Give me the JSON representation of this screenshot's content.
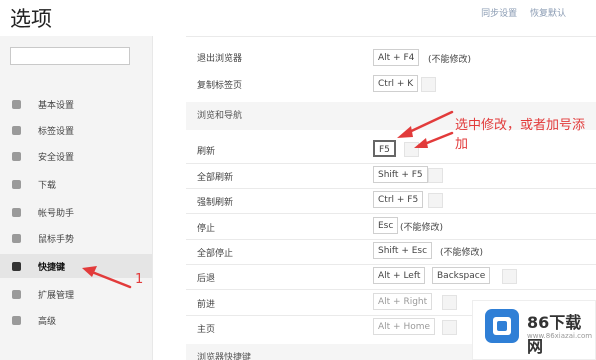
{
  "header": {
    "title": "选项",
    "link1": "同步设置",
    "link2": "恢复默认"
  },
  "sidebar": {
    "search_placeholder": "",
    "items": [
      {
        "label": "基本设置",
        "icon": "settings-icon"
      },
      {
        "label": "标签设置",
        "icon": "tab-icon"
      },
      {
        "label": "安全设置",
        "icon": "shield-icon"
      },
      {
        "label": "下载",
        "icon": "download-icon"
      },
      {
        "label": "帐号助手",
        "icon": "key-icon"
      },
      {
        "label": "鼠标手势",
        "icon": "mouse-icon"
      },
      {
        "label": "快捷键",
        "icon": "shortcut-icon",
        "active": true
      },
      {
        "label": "扩展管理",
        "icon": "puzzle-icon"
      },
      {
        "label": "高级",
        "icon": "more-icon"
      }
    ]
  },
  "shortcuts": {
    "exit": {
      "label": "退出浏览器",
      "key": "Alt + F4",
      "note": "(不能修改)"
    },
    "copy_tab": {
      "label": "复制标签页",
      "key": "Ctrl + K"
    },
    "section_title": "浏览和导航",
    "refresh": {
      "label": "刷新",
      "key": "F5"
    },
    "refresh_all": {
      "label": "全部刷新",
      "key": "Shift + F5"
    },
    "force_refresh": {
      "label": "强制刷新",
      "key": "Ctrl + F5"
    },
    "stop": {
      "label": "停止",
      "key": "Esc",
      "note": "(不能修改)"
    },
    "stop_all": {
      "label": "全部停止",
      "key": "Shift + Esc",
      "note": "(不能修改)"
    },
    "back": {
      "label": "后退",
      "key": "Alt + Left",
      "key2": "Backspace"
    },
    "forward": {
      "label": "前进",
      "key": "Alt + Right"
    },
    "home": {
      "label": "主页",
      "key": "Alt + Home"
    },
    "next_section": "浏览器快捷键"
  },
  "annotations": {
    "text": "选中修改，或者加号添加",
    "number": "1"
  },
  "watermark": {
    "name": "86下载网",
    "url": "www.86xiazai.com"
  },
  "colors": {
    "annotation": "#e23b3b",
    "logo": "#2f7fd6"
  }
}
